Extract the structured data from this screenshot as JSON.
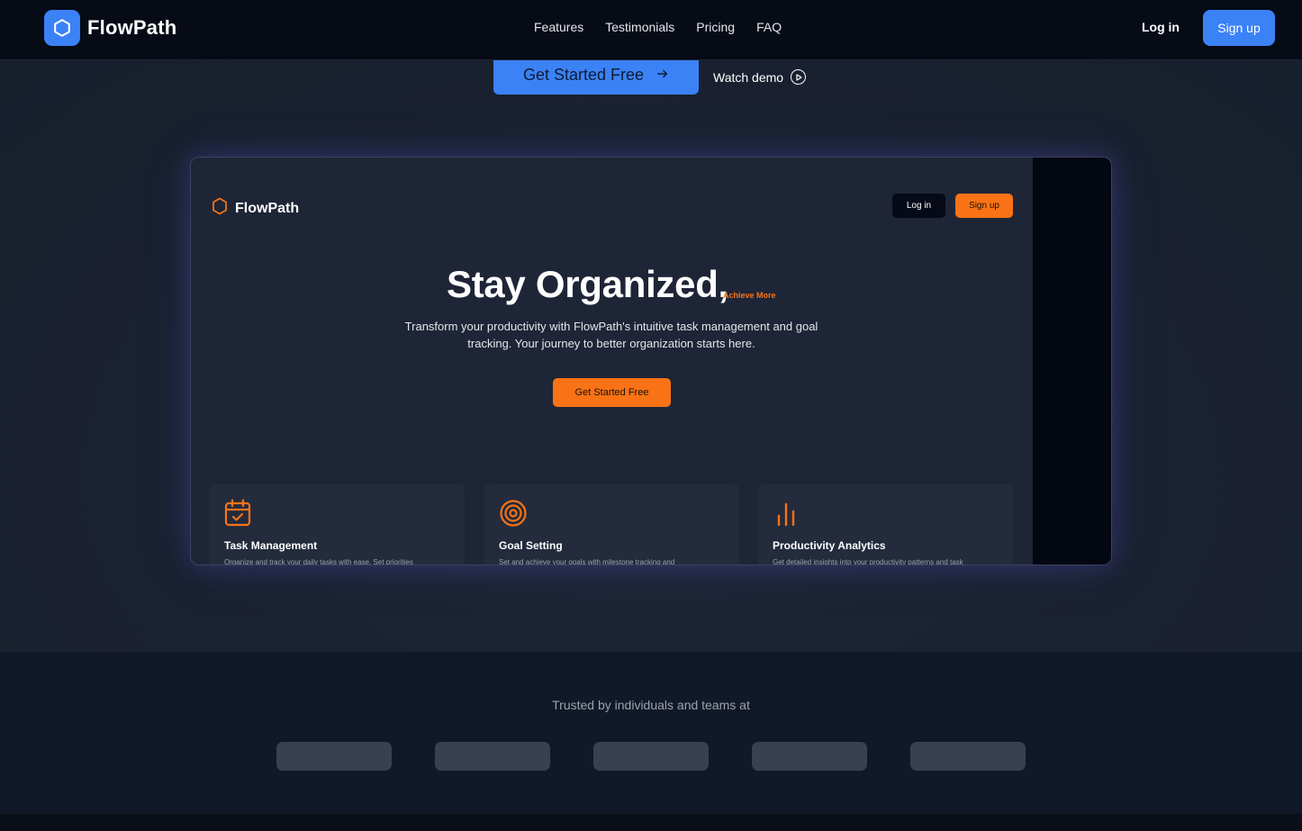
{
  "nav": {
    "brand": "FlowPath",
    "links": [
      "Features",
      "Testimonials",
      "Pricing",
      "FAQ"
    ],
    "login": "Log in",
    "signup": "Sign up",
    "accent_color": "#3b82f6"
  },
  "hero": {
    "cta_primary": "Get Started Free",
    "cta_secondary": "Watch demo"
  },
  "preview": {
    "brand": "FlowPath",
    "login": "Log in",
    "signup": "Sign up",
    "title": "Stay Organized,",
    "title_accent": "Achieve More",
    "subtitle": "Transform your productivity with FlowPath's intuitive task management and goal tracking. Your journey to better organization starts here.",
    "cta": "Get Started Free",
    "accent_color": "#f97316",
    "cards": [
      {
        "icon": "calendar-check-icon",
        "title": "Task Management",
        "desc": "Organize and track your daily tasks with ease. Set priorities"
      },
      {
        "icon": "target-icon",
        "title": "Goal Setting",
        "desc": "Set and achieve your goals with milestone tracking and"
      },
      {
        "icon": "bar-chart-icon",
        "title": "Productivity Analytics",
        "desc": "Get detailed insights into your productivity patterns and task"
      }
    ]
  },
  "trusted": {
    "label": "Trusted by individuals and teams at"
  }
}
